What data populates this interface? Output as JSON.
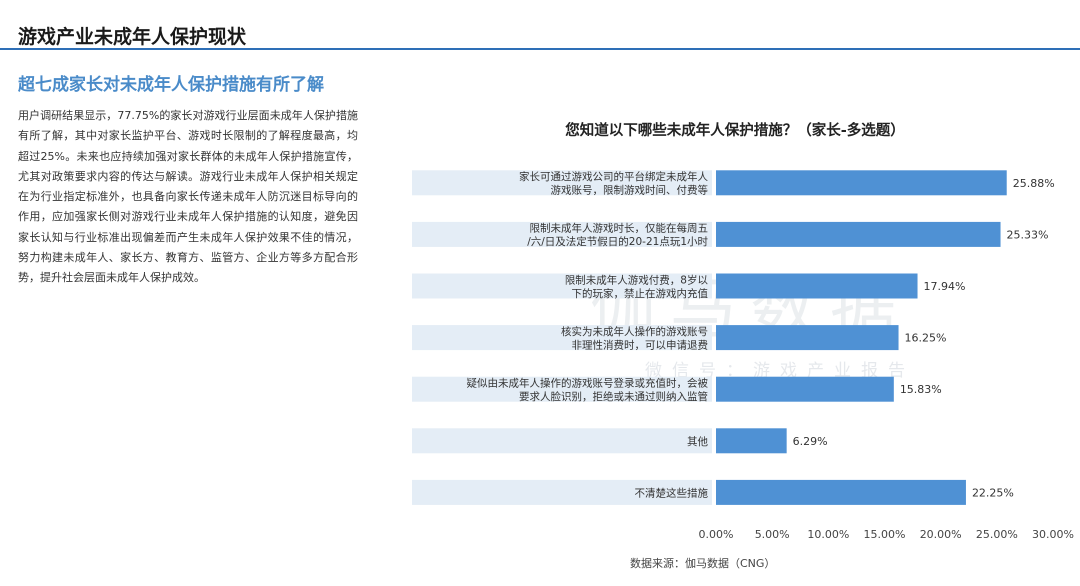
{
  "header": {
    "title": "游戏产业未成年人保护现状",
    "subtitle": "超七成家长对未成年人保护措施有所了解"
  },
  "body": {
    "text": "用户调研结果显示，77.75%的家长对游戏行业层面未成年人保护措施有所了解，其中对家长监护平台、游戏时长限制的了解程度最高，均超过25%。未来也应持续加强对家长群体的未成年人保护措施宣传，尤其对政策要求内容的传达与解读。游戏行业未成年人保护相关规定在为行业指定标准外，也具备向家长传递未成年人防沉迷目标导向的作用，应加强家长侧对游戏行业未成年人保护措施的认知度，避免因家长认知与行业标准出现偏差而产生未成年人保护效果不佳的情况，努力构建未成年人、家长方、教育方、监管方、企业方等多方配合形势，提升社会层面未成年人保护成效。"
  },
  "watermark": {
    "main": "伽马数据",
    "sub": "微信号：游戏产业报告"
  },
  "source": "数据来源：伽马数据（CNG）",
  "colors": {
    "bar": "#4f91d4",
    "label_band": "#e4edf6",
    "accent": "#2e6fb7"
  },
  "chart_data": {
    "type": "bar",
    "orientation": "horizontal",
    "title": "您知道以下哪些未成年人保护措施？（家长-多选题）",
    "categories": [
      [
        "家长可通过游戏公司的平台绑定未成年人",
        "游戏账号，限制游戏时间、付费等"
      ],
      [
        "限制未成年人游戏时长，仅能在每周五",
        "/六/日及法定节假日的20-21点玩1小时"
      ],
      [
        "限制未成年人游戏付费，8岁以",
        "下的玩家，禁止在游戏内充值"
      ],
      [
        "核实为未成年人操作的游戏账号",
        "非理性消费时，可以申请退费"
      ],
      [
        "疑似由未成年人操作的游戏账号登录或充值时，会被",
        "要求人脸识别，拒绝或未通过则纳入监管"
      ],
      [
        "其他"
      ],
      [
        "不清楚这些措施"
      ]
    ],
    "values": [
      25.88,
      25.33,
      17.94,
      16.25,
      15.83,
      6.29,
      22.25
    ],
    "value_labels": [
      "25.88%",
      "25.33%",
      "17.94%",
      "16.25%",
      "15.83%",
      "6.29%",
      "22.25%"
    ],
    "xlim": [
      0,
      30
    ],
    "xticks": [
      "0.00%",
      "5.00%",
      "10.00%",
      "15.00%",
      "20.00%",
      "25.00%",
      "30.00%"
    ],
    "grid": false,
    "legend": "none"
  }
}
